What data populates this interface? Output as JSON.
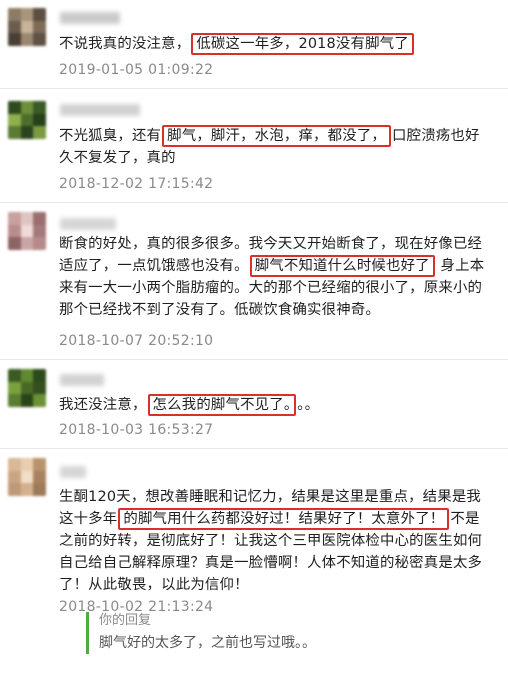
{
  "comments": [
    {
      "parts": [
        {
          "t": "不说我真的没注意，"
        },
        {
          "t": "低碳这一年多，2018没有脚气了",
          "hl": true
        }
      ],
      "time": "2019-01-05 01:09:22"
    },
    {
      "parts": [
        {
          "t": "不光狐臭，还有"
        },
        {
          "t": "脚气，脚汗，水泡，痒，都没了，",
          "hl": true
        },
        {
          "t": "口腔溃疡也好久不复发了，真的"
        }
      ],
      "time": "2018-12-02 17:15:42"
    },
    {
      "parts": [
        {
          "t": "断食的好处，真的很多很多。我今天又开始断食了，现在好像已经适应了，一点饥饿感也没有。"
        },
        {
          "t": "脚气不知道什么时候也好了",
          "hl": true
        },
        {
          "t": " 身上本来有一大一小两个脂肪瘤的。大的那个已经缩的很小了，原来小的那个已经找不到了没有了。低碳饮食确实很神奇。"
        }
      ],
      "time": "2018-10-07 20:52:10"
    },
    {
      "parts": [
        {
          "t": "我还没注意，"
        },
        {
          "t": "怎么我的脚气不见了。",
          "hl": true
        },
        {
          "t": "。。"
        }
      ],
      "time": "2018-10-03 16:53:27"
    },
    {
      "parts": [
        {
          "t": "生酮120天，想改善睡眠和记忆力，结果是这里是重点，结果是我这十多年"
        },
        {
          "t": "的脚气用什么药都没好过！结果好了！太意外了！",
          "hl": true
        },
        {
          "t": "不是之前的好转，是彻底好了！让我这个三甲医院体检中心的医生如何自己给自己解释原理？真是一脸懵啊！人体不知道的秘密真是太多了！从此敬畏，以此为信仰！"
        }
      ],
      "time": "2018-10-02 21:13:24"
    }
  ],
  "reply": {
    "label": "你的回复",
    "text": "脚气好的太多了，之前也写过哦。。"
  },
  "colors": {
    "highlight_border": "#d9302a",
    "reply_bar": "#52a842",
    "timestamp": "#8a8a8a"
  }
}
